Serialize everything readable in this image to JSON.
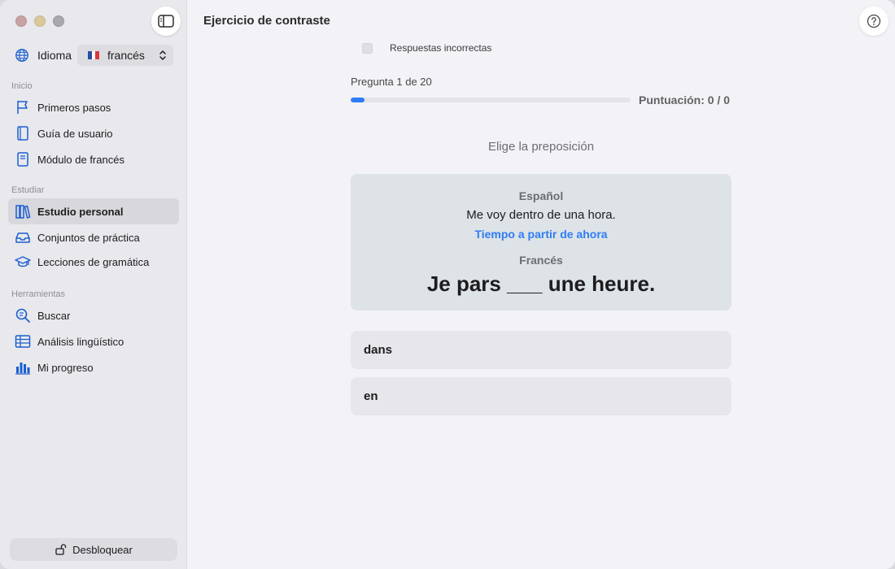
{
  "window": {
    "title": "Ejercicio de contraste"
  },
  "sidebar": {
    "language": {
      "label": "Idioma",
      "selected": "francés"
    },
    "sections": [
      {
        "title": "Inicio",
        "items": [
          {
            "label": "Primeros pasos",
            "icon": "flag-icon"
          },
          {
            "label": "Guía de usuario",
            "icon": "book-icon"
          },
          {
            "label": "Módulo de francés",
            "icon": "module-book-icon"
          }
        ]
      },
      {
        "title": "Estudiar",
        "items": [
          {
            "label": "Estudio personal",
            "icon": "books-icon",
            "active": true
          },
          {
            "label": "Conjuntos de práctica",
            "icon": "tray-icon"
          },
          {
            "label": "Lecciones de gramática",
            "icon": "graduation-cap-icon"
          }
        ]
      },
      {
        "title": "Herramientas",
        "items": [
          {
            "label": "Buscar",
            "icon": "search-icon"
          },
          {
            "label": "Análisis lingüístico",
            "icon": "table-icon"
          },
          {
            "label": "Mi progreso",
            "icon": "bar-chart-icon"
          }
        ]
      }
    ],
    "unlock_label": "Desbloquear"
  },
  "main": {
    "filter_label": "Respuestas incorrectas",
    "question_counter": "Pregunta 1 de 20",
    "progress_fraction": 0.05,
    "score": "Puntuación: 0 / 0",
    "prompt": "Elige la preposición",
    "card": {
      "source_language": "Español",
      "source_text": "Me voy dentro de una hora.",
      "hint": "Tiempo a partir de ahora",
      "target_language": "Francés",
      "target_text": "Je pars ___ une heure."
    },
    "options": [
      "dans",
      "en"
    ]
  },
  "colors": {
    "accent": "#2f7cf6",
    "sidebar_bg": "#e8e8ed",
    "card_bg": "#dde3e6"
  }
}
